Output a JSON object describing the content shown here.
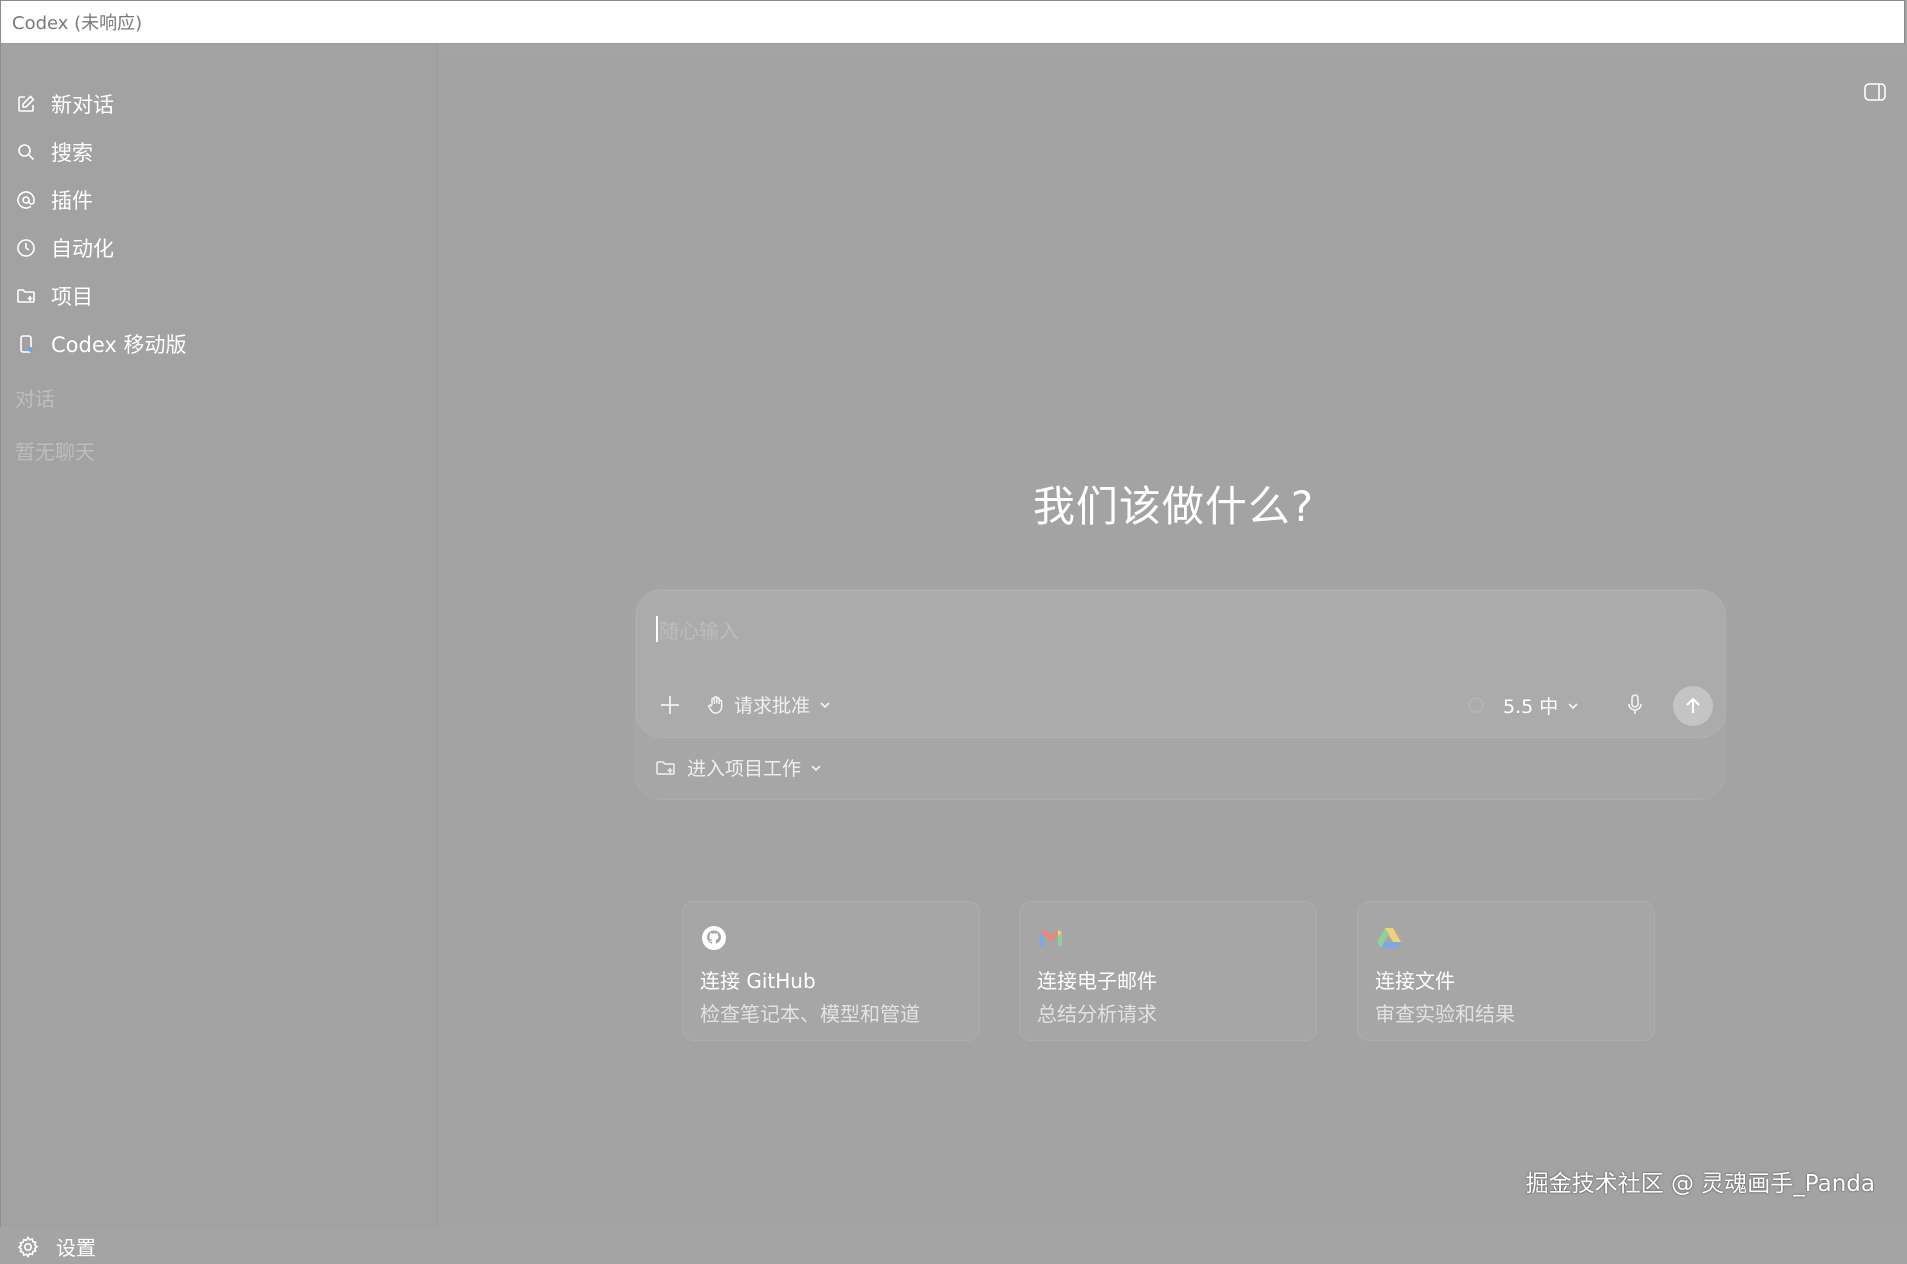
{
  "window": {
    "title": "Codex (未响应)"
  },
  "sidebar": {
    "items": [
      {
        "label": "新对话",
        "icon": "edit-icon"
      },
      {
        "label": "搜索",
        "icon": "search-icon"
      },
      {
        "label": "插件",
        "icon": "at-icon"
      },
      {
        "label": "自动化",
        "icon": "clock-icon"
      },
      {
        "label": "项目",
        "icon": "folder-plus-icon"
      },
      {
        "label": "Codex 移动版",
        "icon": "mobile-icon"
      }
    ],
    "section_label": "对话",
    "empty_label": "暂无聊天",
    "settings_label": "设置"
  },
  "main": {
    "heading": "我们该做什么?",
    "composer": {
      "placeholder": "随心输入",
      "approval_label": "请求批准",
      "model_label": "5.5 中",
      "project_label": "进入项目工作"
    },
    "cards": [
      {
        "title": "连接 GitHub",
        "subtitle": "检查笔记本、模型和管道",
        "icon": "github-icon"
      },
      {
        "title": "连接电子邮件",
        "subtitle": "总结分析请求",
        "icon": "gmail-icon"
      },
      {
        "title": "连接文件",
        "subtitle": "审查实验和结果",
        "icon": "drive-icon"
      }
    ]
  },
  "watermark": "掘金技术社区 @ 灵魂画手_Panda",
  "colors": {
    "background": "#a3a3a3",
    "text": "#ffffff",
    "muted": "#bdbdbd"
  }
}
